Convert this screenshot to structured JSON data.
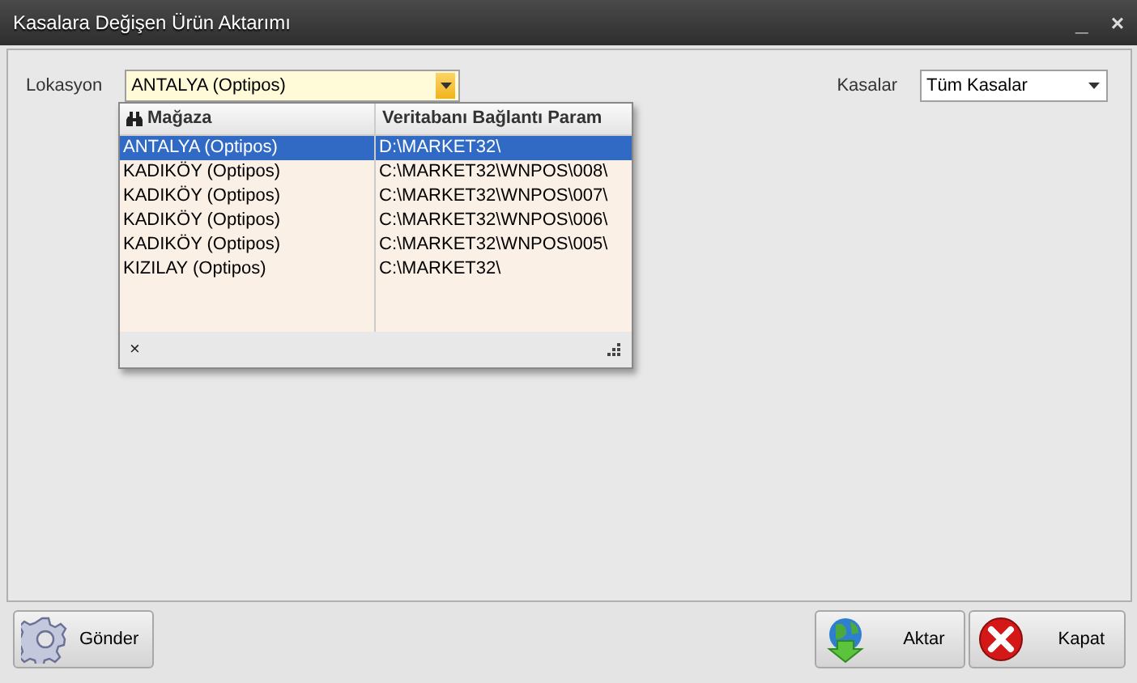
{
  "window": {
    "title": "Kasalara Değişen Ürün Aktarımı",
    "controls": [
      "_",
      "×"
    ]
  },
  "lokasyon": {
    "label": "Lokasyon",
    "value": "ANTALYA (Optipos)"
  },
  "kasalar": {
    "label": "Kasalar",
    "value": "Tüm Kasalar"
  },
  "popup": {
    "columns": [
      "Mağaza",
      "Veritabanı Bağlantı Param"
    ],
    "rows": [
      {
        "cells": [
          "ANTALYA (Optipos)",
          "D:\\MARKET32\\"
        ],
        "selected": true
      },
      {
        "cells": [
          "KADIKÖY (Optipos)",
          "C:\\MARKET32\\WNPOS\\008\\"
        ],
        "selected": false
      },
      {
        "cells": [
          "KADIKÖY (Optipos)",
          "C:\\MARKET32\\WNPOS\\007\\"
        ],
        "selected": false
      },
      {
        "cells": [
          "KADIKÖY (Optipos)",
          "C:\\MARKET32\\WNPOS\\006\\"
        ],
        "selected": false
      },
      {
        "cells": [
          "KADIKÖY (Optipos)",
          "C:\\MARKET32\\WNPOS\\005\\"
        ],
        "selected": false
      },
      {
        "cells": [
          "KIZILAY (Optipos)",
          "C:\\MARKET32\\"
        ],
        "selected": false
      }
    ],
    "close": "×"
  },
  "buttons": [
    {
      "kind": "gear",
      "label": "Gönder"
    },
    {
      "kind": "globe",
      "label": "Aktar"
    },
    {
      "kind": "close",
      "label": "Kapat"
    }
  ]
}
